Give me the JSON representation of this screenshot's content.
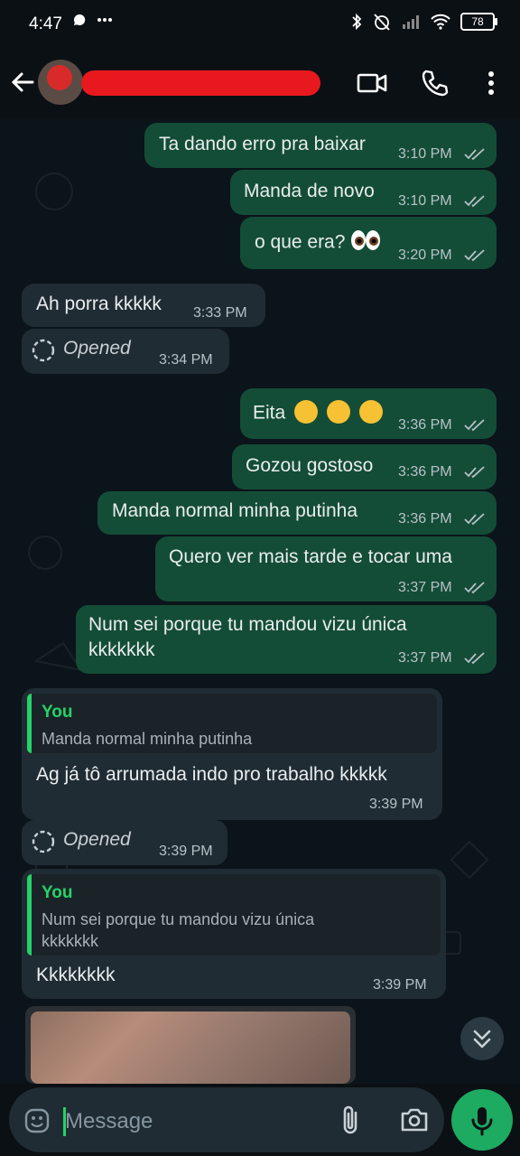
{
  "status_bar": {
    "time": "4:47",
    "battery": "78"
  },
  "header": {
    "contact_name": "",
    "icons": [
      "back-arrow-icon",
      "video-call-icon",
      "voice-call-icon",
      "more-vert-icon"
    ]
  },
  "messages": [
    {
      "id": 1,
      "direction": "out",
      "text": "Ta dando erro pra baixar",
      "time": "3:10 PM",
      "status": "read"
    },
    {
      "id": 2,
      "direction": "out",
      "text": "Manda de novo",
      "time": "3:10 PM",
      "status": "read"
    },
    {
      "id": 3,
      "direction": "out",
      "text": "o que era?",
      "emoji": "eyes-emoji",
      "time": "3:20 PM",
      "status": "read"
    },
    {
      "id": 4,
      "direction": "in",
      "text": "Ah porra kkkkk",
      "time": "3:33 PM"
    },
    {
      "id": 5,
      "direction": "in",
      "type": "view-once-opened",
      "text": "Opened",
      "time": "3:34 PM"
    },
    {
      "id": 6,
      "direction": "out",
      "text": "Eita",
      "emoji": "drooling-face-emoji x3",
      "time": "3:36 PM",
      "status": "read"
    },
    {
      "id": 7,
      "direction": "out",
      "text": "Gozou gostoso",
      "time": "3:36 PM",
      "status": "read"
    },
    {
      "id": 8,
      "direction": "out",
      "text": "Manda normal minha putinha",
      "time": "3:36 PM",
      "status": "read"
    },
    {
      "id": 9,
      "direction": "out",
      "text": "Quero ver mais tarde e tocar uma",
      "time": "3:37 PM",
      "status": "read"
    },
    {
      "id": 10,
      "direction": "out",
      "text_line1": "Num sei porque tu mandou vizu única",
      "text_line2": "kkkkkkk",
      "time": "3:37 PM",
      "status": "read"
    },
    {
      "id": 11,
      "direction": "in",
      "quote_author": "You",
      "quote_text": "Manda normal minha putinha",
      "text": "Ag já tô arrumada indo pro trabalho kkkkk",
      "time": "3:39 PM"
    },
    {
      "id": 12,
      "direction": "in",
      "type": "view-once-opened",
      "text": "Opened",
      "time": "3:39 PM"
    },
    {
      "id": 13,
      "direction": "in",
      "quote_author": "You",
      "quote_text_line1": "Num sei porque tu mandou vizu única",
      "quote_text_line2": "kkkkkkk",
      "text": "Kkkkkkkk",
      "time": "3:39 PM"
    },
    {
      "id": 14,
      "direction": "in",
      "type": "image"
    }
  ],
  "input": {
    "placeholder": "Message",
    "icons": [
      "emoji-icon",
      "attach-icon",
      "camera-icon",
      "mic-icon"
    ]
  },
  "colors": {
    "outgoing_bubble": "#144d37",
    "incoming_bubble": "#202c33",
    "accent": "#25d366",
    "mic_button": "#1daa61"
  }
}
